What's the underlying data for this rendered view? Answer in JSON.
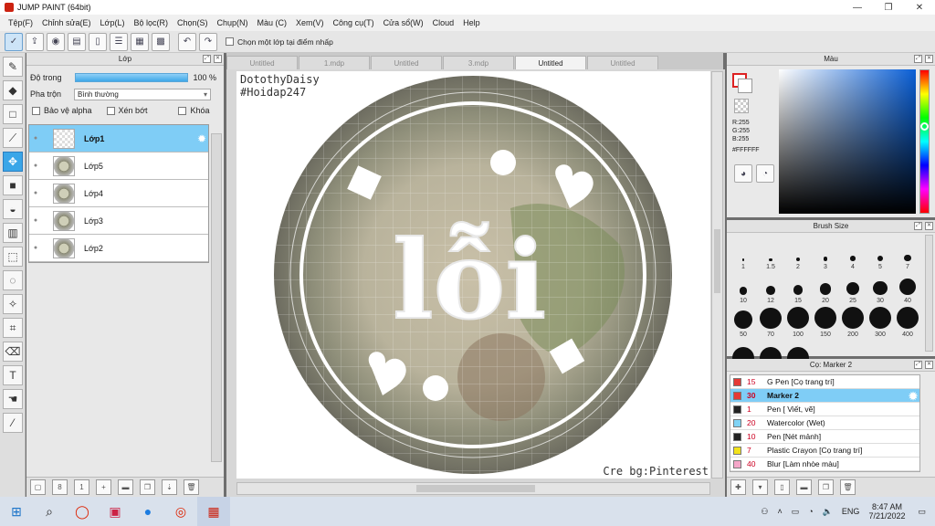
{
  "window": {
    "title": "JUMP PAINT (64bit)",
    "min": "—",
    "max": "❐",
    "close": "✕"
  },
  "menu": [
    "Tệp(F)",
    "Chỉnh sửa(E)",
    "Lớp(L)",
    "Bộ lọc(R)",
    "Chọn(S)",
    "Chụp(N)",
    "Màu (C)",
    "Xem(V)",
    "Công cụ(T)",
    "Cửa sổ(W)",
    "Cloud",
    "Help"
  ],
  "toolbar": {
    "checkbox_label": "Chọn một lớp tại điểm nhấp",
    "undo": "↶",
    "redo": "↷"
  },
  "layer_panel": {
    "title": "Lớp",
    "opacity_label": "Độ trong",
    "opacity_value": "100 %",
    "opacity_fraction": 1.0,
    "blend_label": "Pha trộn",
    "blend_value": "Bình thường",
    "protect_alpha": "Bảo vệ alpha",
    "clipping": "Xén bớt",
    "lock": "Khóa",
    "layers": [
      {
        "name": "Lớp1",
        "selected": true
      },
      {
        "name": "Lớp5",
        "selected": false
      },
      {
        "name": "Lớp4",
        "selected": false
      },
      {
        "name": "Lớp3",
        "selected": false
      },
      {
        "name": "Lớp2",
        "selected": false
      }
    ]
  },
  "tabs": [
    {
      "label": "Untitled",
      "active": false
    },
    {
      "label": "1.mdp",
      "active": false
    },
    {
      "label": "Untitled",
      "active": false
    },
    {
      "label": "3.mdp",
      "active": false
    },
    {
      "label": "Untitled",
      "active": true
    },
    {
      "label": "Untitled",
      "active": false
    }
  ],
  "canvas": {
    "watermark_line1": "DotothyDaisy",
    "watermark_line2": "#Hoidap247",
    "center_text": "lỗi",
    "credit": "Cre bg:Pinterest"
  },
  "color_panel": {
    "title": "Màu",
    "r": "R:255",
    "g": "G:255",
    "b": "B:255",
    "hex": "#FFFFFF",
    "hue_color": "#0a5fd6"
  },
  "brush_panel": {
    "title": "Brush Size",
    "sizes": [
      "1",
      "1.5",
      "2",
      "3",
      "4",
      "5",
      "7",
      "10",
      "12",
      "15",
      "20",
      "25",
      "30",
      "40",
      "50",
      "70",
      "100",
      "150",
      "200",
      "300",
      "400",
      "",
      "",
      ""
    ]
  },
  "preset_panel": {
    "title": "Cọ: Marker 2",
    "items": [
      {
        "size": "15",
        "name": "G Pen [Cọ trang trí]",
        "color": "#e53935",
        "selected": false
      },
      {
        "size": "30",
        "name": "Marker 2",
        "color": "#e53935",
        "selected": true
      },
      {
        "size": "1",
        "name": "Pen [ Viết, vẽ]",
        "color": "#222222",
        "selected": false
      },
      {
        "size": "20",
        "name": "Watercolor (Wet)",
        "color": "#7fd3f5",
        "selected": false
      },
      {
        "size": "10",
        "name": "Pen [Nét mảnh]",
        "color": "#222222",
        "selected": false
      },
      {
        "size": "7",
        "name": "Plastic Crayon [Cọ trang trí]",
        "color": "#f2e21b",
        "selected": false
      },
      {
        "size": "40",
        "name": "Blur [Làm nhòe màu]",
        "color": "#f4a6c8",
        "selected": false
      }
    ]
  },
  "taskbar": {
    "language": "ENG",
    "time": "8:47 AM",
    "date": "7/21/2022"
  }
}
